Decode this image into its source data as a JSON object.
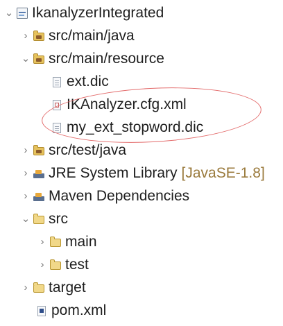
{
  "tree": {
    "project": {
      "name": "IkanalyzerIntegrated",
      "twisty": "⌄"
    },
    "src_main_java": {
      "name": "src/main/java",
      "twisty": "›"
    },
    "src_main_resource": {
      "name": "src/main/resource",
      "twisty": "⌄"
    },
    "ext_dic": {
      "name": "ext.dic"
    },
    "ik_cfg": {
      "name": "IKAnalyzer.cfg.xml"
    },
    "stopword": {
      "name": "my_ext_stopword.dic"
    },
    "src_test_java": {
      "name": "src/test/java",
      "twisty": "›"
    },
    "jre": {
      "name": "JRE System Library",
      "decoration": "[JavaSE-1.8]",
      "twisty": "›"
    },
    "maven": {
      "name": "Maven Dependencies",
      "twisty": "›"
    },
    "src": {
      "name": "src",
      "twisty": "⌄"
    },
    "main": {
      "name": "main",
      "twisty": "›"
    },
    "test": {
      "name": "test",
      "twisty": "›"
    },
    "target": {
      "name": "target",
      "twisty": "›"
    },
    "pom": {
      "name": "pom.xml"
    }
  },
  "annotation_color": "#e36b6b"
}
